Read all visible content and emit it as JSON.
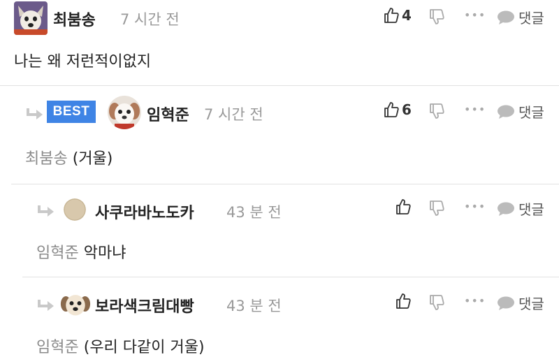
{
  "colors": {
    "best_badge": "#3f84e5",
    "divider": "#e2e2e2",
    "muted": "#999999"
  },
  "comments": [
    {
      "author": "최붐송",
      "time": "7 시간 전",
      "text": "나는 왜 저런적이없지",
      "likes": "4",
      "avatar_icon": "dog-avatar-icon",
      "reply_label": "댓글"
    },
    {
      "badge": "BEST",
      "author": "임혁준",
      "time": "7 시간 전",
      "mention": "최붐송",
      "text": "(거울)",
      "likes": "6",
      "avatar_icon": "puppy-avatar-icon",
      "reply_label": "댓글"
    },
    {
      "author": "사쿠라바노도카",
      "time": "43 분 전",
      "mention": "임혁준",
      "text": "악마냐",
      "likes": "",
      "avatar_icon": "default-avatar-icon",
      "reply_label": "댓글"
    },
    {
      "author": "보라색크림대빵",
      "time": "43 분 전",
      "mention": "임혁준",
      "text": "(우리 다같이 거울)",
      "likes": "",
      "avatar_icon": "puppy-avatar-icon",
      "reply_label": "댓글"
    }
  ]
}
